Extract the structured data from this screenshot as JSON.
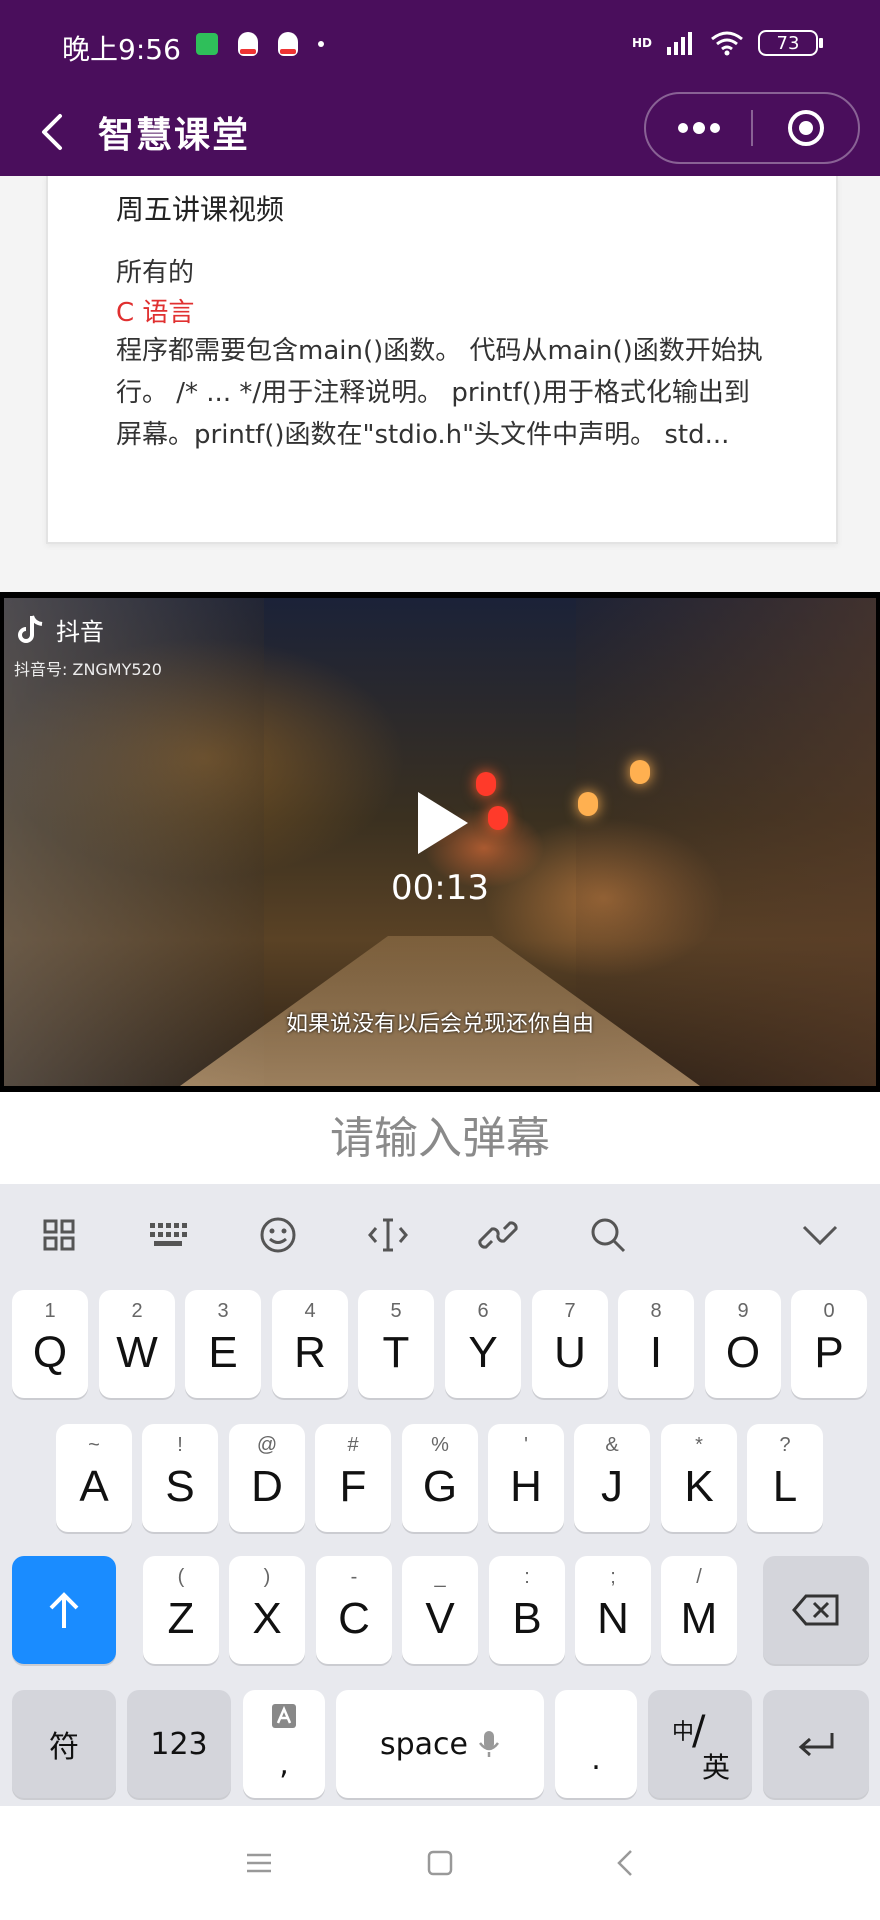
{
  "status_bar": {
    "time": "晚上9:56",
    "network": "HD",
    "battery": "73",
    "icons": [
      "app-notification-icon",
      "qq-icon",
      "qq-icon",
      "dot-icon",
      "signal-icon",
      "wifi-icon",
      "battery-icon"
    ]
  },
  "header": {
    "title": "智慧课堂",
    "back_icon": "chevron-left-icon",
    "more_icon": "more-dots-icon",
    "close_icon": "target-circle-icon"
  },
  "card": {
    "title": "周五讲课视频",
    "line1": "所有的",
    "highlight": "C 语言",
    "body": "程序都需要包含main()函数。 代码从main()函数开始执行。 /* ... */用于注释说明。 printf()用于格式化输出到屏幕。printf()函数在\"stdio.h\"头文件中声明。 std...",
    "highlight_color": "#e03030"
  },
  "video": {
    "watermark": "抖音",
    "watermark_id": "抖音号: ZNGMY520",
    "time": "00:13",
    "subtitle": "如果说没有以后会兑现还你自由"
  },
  "danmu": {
    "placeholder": "请输入弹幕"
  },
  "keyboard": {
    "toolbar": [
      "apps-grid-icon",
      "keyboard-icon",
      "emoji-icon",
      "cursor-icon",
      "clipboard-icon",
      "search-icon",
      "collapse-chevron-icon"
    ],
    "row1": [
      {
        "main": "Q",
        "sub": "1"
      },
      {
        "main": "W",
        "sub": "2"
      },
      {
        "main": "E",
        "sub": "3"
      },
      {
        "main": "R",
        "sub": "4"
      },
      {
        "main": "T",
        "sub": "5"
      },
      {
        "main": "Y",
        "sub": "6"
      },
      {
        "main": "U",
        "sub": "7"
      },
      {
        "main": "I",
        "sub": "8"
      },
      {
        "main": "O",
        "sub": "9"
      },
      {
        "main": "P",
        "sub": "0"
      }
    ],
    "row2": [
      {
        "main": "A",
        "sub": "~"
      },
      {
        "main": "S",
        "sub": "!"
      },
      {
        "main": "D",
        "sub": "@"
      },
      {
        "main": "F",
        "sub": "#"
      },
      {
        "main": "G",
        "sub": "%"
      },
      {
        "main": "H",
        "sub": "'"
      },
      {
        "main": "J",
        "sub": "&"
      },
      {
        "main": "K",
        "sub": "*"
      },
      {
        "main": "L",
        "sub": "?"
      }
    ],
    "row3": [
      {
        "main": "Z",
        "sub": "("
      },
      {
        "main": "X",
        "sub": ")"
      },
      {
        "main": "C",
        "sub": "-"
      },
      {
        "main": "V",
        "sub": "_"
      },
      {
        "main": "B",
        "sub": ":"
      },
      {
        "main": "N",
        "sub": ";"
      },
      {
        "main": "M",
        "sub": "/"
      }
    ],
    "symbols_label": "符",
    "numbers_label": "123",
    "comma_label": ",",
    "space_label": "space",
    "period_label": ".",
    "lang_top": "中",
    "lang_bottom": "英",
    "shift_color": "#1a8cff"
  },
  "system_nav": [
    "menu-lines-icon",
    "home-square-icon",
    "back-chevron-icon"
  ]
}
